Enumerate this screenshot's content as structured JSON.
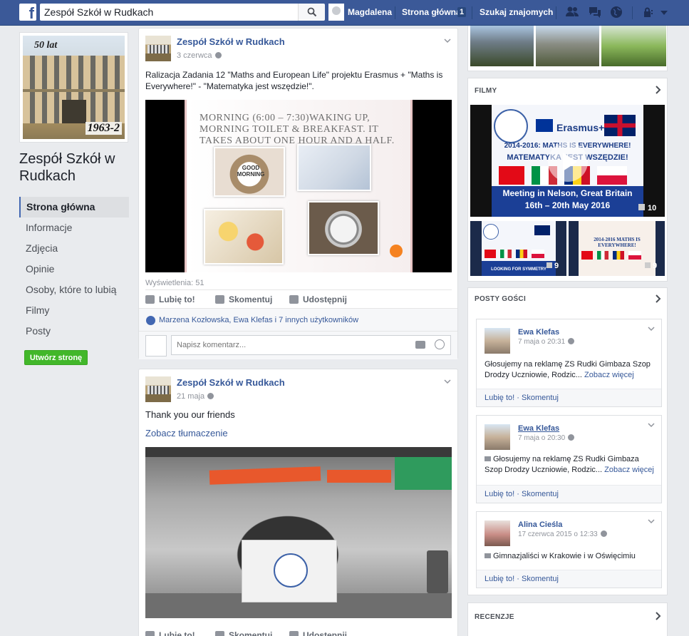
{
  "topbar": {
    "logo": "f",
    "search_value": "Zespół Szkół w Rudkach",
    "user_name": "Magdalena",
    "home_label": "Strona główna",
    "home_count": "1",
    "find_friends": "Szukaj znajomych"
  },
  "page": {
    "cover_text_top": "50 lat",
    "cover_text_bottom": "1963-2",
    "name": "Zespół Szkół w Rudkach",
    "create_page": "Utwórz stronę"
  },
  "nav": [
    {
      "label": "Strona główna",
      "active": true
    },
    {
      "label": "Informacje"
    },
    {
      "label": "Zdjęcia"
    },
    {
      "label": "Opinie"
    },
    {
      "label": "Osoby, które to lubią"
    },
    {
      "label": "Filmy"
    },
    {
      "label": "Posty"
    }
  ],
  "post1": {
    "author": "Zespół Szkół w Rudkach",
    "date": "3 czerwca",
    "text": "Ralizacja Zadania 12 \"Maths and European Life\" projektu Erasmus + \"Maths is Everywhere!\" - \"Matematyka jest wszędzie!\".",
    "slide_text": "MORNING (6:00 – 7:30)WAKING UP, MORNING TOILET & BREAKFAST. IT TAKES ABOUT ONE HOUR AND A HALF.",
    "slide_sign": "GOOD MORNING",
    "views": "Wyświetlenia: 51",
    "like": "Lubię to!",
    "comment": "Skomentuj",
    "share": "Udostępnij",
    "likers": "Marzena Kozłowska, Ewa Klefas i 7 innych użytkowników",
    "comment_placeholder": "Napisz komentarz..."
  },
  "post2": {
    "author": "Zespół Szkół w Rudkach",
    "date": "21 maja",
    "text": "Thank you our friends",
    "translate": "Zobacz tłumaczenie",
    "like": "Lubię to!",
    "comment": "Skomentuj",
    "share": "Udostępnij"
  },
  "videos": {
    "title": "FILMY",
    "main_line1": "2014-2016: MATHS IS EVERYWHERE!",
    "main_line2": "MATEMATYKA JEST WSZĘDZIE!",
    "main_line3": "Meeting in Nelson, Great Britain",
    "main_line4": "16th – 20th May 2016",
    "main_brand": "Erasmus+",
    "main_count": "10",
    "thumb1_count": "9",
    "thumb2_count": "9",
    "thumb1_text": "LOOKING FOR SYMMETRY",
    "thumb2_text": "2014-2016 MATHS IS EVERYWHERE!"
  },
  "guest_posts": {
    "title": "POSTY GOŚCI",
    "items": [
      {
        "name": "Ewa Klefas",
        "date": "7 maja o 20:31",
        "text": "Głosujemy na reklamę ZS Rudki Gimbaza Szop Drodzy Uczniowie, Rodzic...",
        "more": "Zobacz więcej",
        "like": "Lubię to!",
        "comment": "Skomentuj"
      },
      {
        "name": "Ewa Klefas",
        "date": "7 maja o 20:30",
        "text": "Głosujemy na reklamę ZS Rudki Gimbaza Szop Drodzy Uczniowie, Rodzic...",
        "more": "Zobacz więcej",
        "like": "Lubię to!",
        "comment": "Skomentuj"
      },
      {
        "name": "Alina Cieśla",
        "date": "17 czerwca 2015 o 12:33",
        "text": "Gimnazjaliści w Krakowie i w Oświęcimiu",
        "like": "Lubię to!",
        "comment": "Skomentuj"
      }
    ]
  },
  "reviews": {
    "title": "RECENZJE"
  },
  "colors": {
    "brand": "#3b5998",
    "link": "#365899",
    "green": "#42b72a",
    "background": "#e9ebee"
  }
}
